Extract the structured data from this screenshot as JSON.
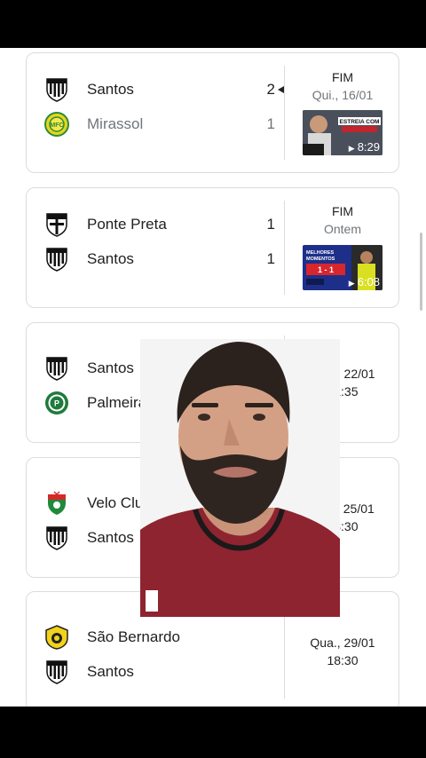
{
  "matches": [
    {
      "home": {
        "name": "Santos",
        "score": "2",
        "crest": "santos-crest-icon"
      },
      "away": {
        "name": "Mirassol",
        "score": "1",
        "crest": "mirassol-crest-icon"
      },
      "status": "FIM",
      "date": "Qui., 16/01",
      "video": {
        "duration": "8:29",
        "caption": "ESTREIA COM"
      }
    },
    {
      "home": {
        "name": "Ponte Preta",
        "score": "1",
        "crest": "ponte-preta-crest-icon"
      },
      "away": {
        "name": "Santos",
        "score": "1",
        "crest": "santos-crest-icon"
      },
      "status": "FIM",
      "date": "Ontem",
      "video": {
        "duration": "6:08",
        "caption": "MELHORES MOMENTOS",
        "score": "1 - 1"
      }
    },
    {
      "home": {
        "name": "Santos",
        "crest": "santos-crest-icon"
      },
      "away": {
        "name": "Palmeiras",
        "crest": "palmeiras-crest-icon"
      },
      "date": "Qua., 22/01",
      "time": "21:35"
    },
    {
      "home": {
        "name": "Velo Clube",
        "crest": "velo-clube-crest-icon"
      },
      "away": {
        "name": "Santos",
        "crest": "santos-crest-icon"
      },
      "date": "Sáb., 25/01",
      "time": "18:30"
    },
    {
      "home": {
        "name": "São Bernardo",
        "crest": "sao-bernardo-crest-icon"
      },
      "away": {
        "name": "Santos",
        "crest": "santos-crest-icon"
      },
      "date": "Qua., 29/01",
      "time": "18:30"
    }
  ],
  "colors": {
    "muted": "#70757a",
    "text": "#202124",
    "border": "#dcdcdc"
  }
}
